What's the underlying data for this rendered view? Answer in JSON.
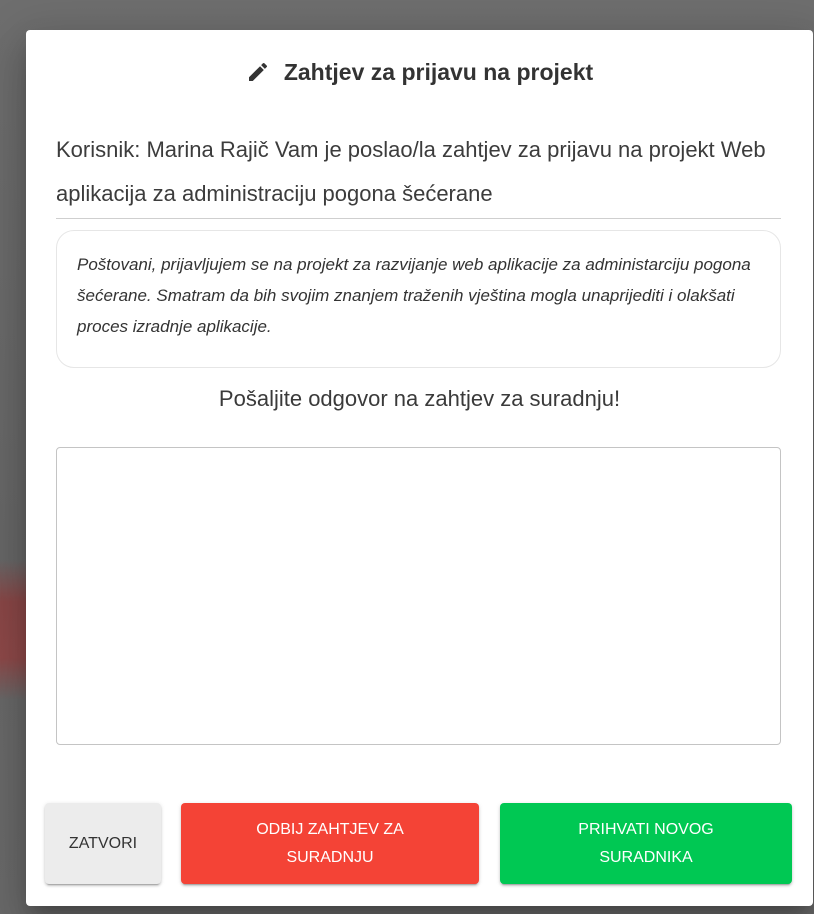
{
  "dialog": {
    "title": "Zahtjev za prijavu na projekt",
    "title_icon": "pencil-icon",
    "intro": "Korisnik: Marina Rajič Vam je poslao/la zahtjev za prijavu na projekt Web aplikacija za administraciju pogona šećerane",
    "message": "Poštovani, prijavljujem se na projekt za razvijanje web aplikacije za administarciju pogona šećerane. Smatram da bih svojim znanjem traženih vještina mogla unaprijediti i olakšati proces izradnje aplikacije.",
    "reply_prompt": "Pošaljite odgovor na zahtjev za suradnju!",
    "reply_value": "",
    "buttons": {
      "close": "ZATVORI",
      "reject": "ODBIJ ZAHTJEV ZA SURADNJU",
      "accept": "PRIHVATI NOVOG SURADNIKA"
    }
  },
  "colors": {
    "reject": "#f44336",
    "accept": "#00c853",
    "close": "#ececec",
    "overlay": "#6b6b6b"
  }
}
